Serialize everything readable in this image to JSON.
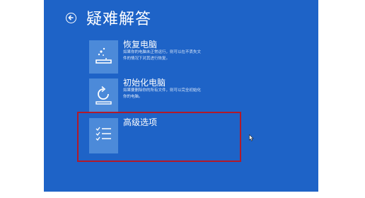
{
  "header": {
    "title": "疑难解答",
    "back_icon": "back-arrow-icon"
  },
  "options": [
    {
      "label": "恢复电脑",
      "description": "如果你的电脑未正常运行，则可以在不丢失文件的情况下对其进行恢复。",
      "icon": "refresh-pc-icon"
    },
    {
      "label": "初始化电脑",
      "description": "如果要删除你的所有文件，则可以完全初始化你的电脑。",
      "icon": "reset-pc-icon"
    },
    {
      "label": "高级选项",
      "description": "",
      "icon": "advanced-options-checklist-icon"
    }
  ],
  "colors": {
    "background": "#1e63c7",
    "tile": "#4c8ad9",
    "highlight": "#b21a2a"
  }
}
